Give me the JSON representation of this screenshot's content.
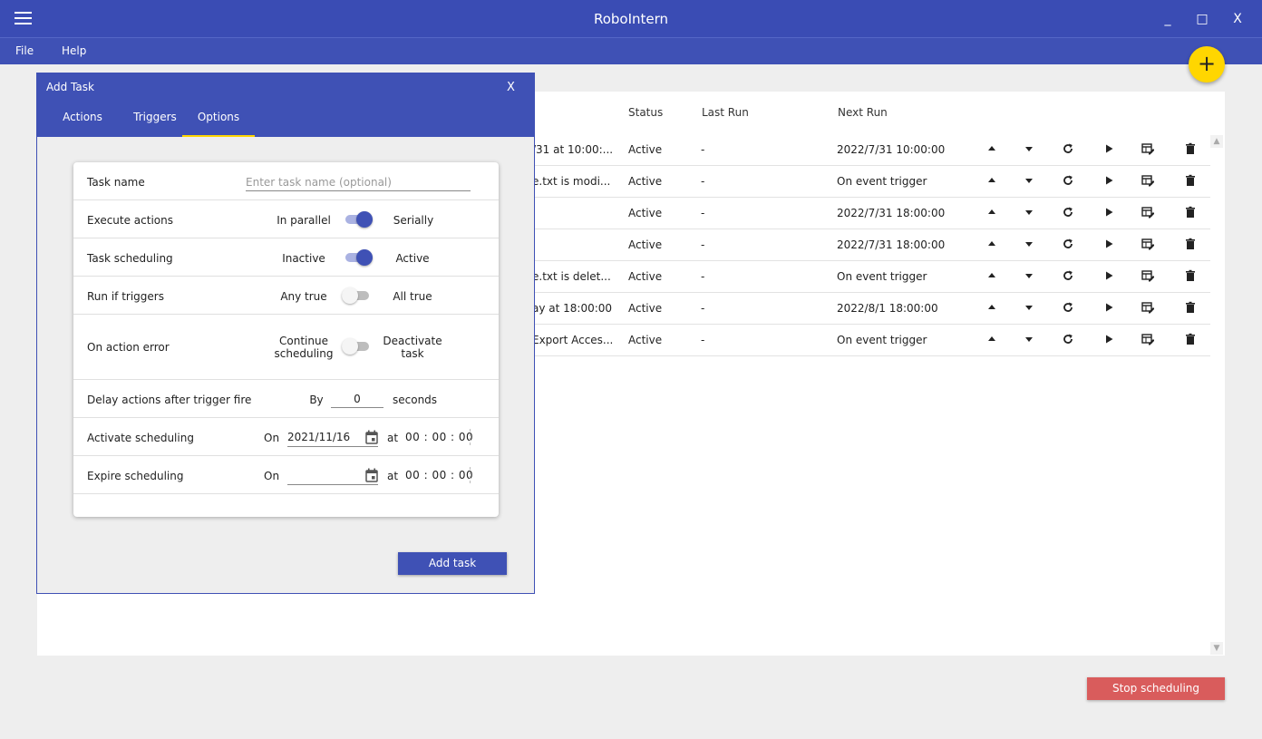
{
  "window": {
    "title": "RoboIntern",
    "minimize": "_",
    "maximize": "□",
    "close": "X"
  },
  "menu": {
    "file": "File",
    "help": "Help"
  },
  "table": {
    "headers": {
      "status": "Status",
      "last_run": "Last Run",
      "next_run": "Next Run"
    },
    "rows": [
      {
        "name": "/31 at 10:00:...",
        "status": "Active",
        "last_run": "-",
        "next_run": "2022/7/31 10:00:00"
      },
      {
        "name": "e.txt is modi...",
        "status": "Active",
        "last_run": "-",
        "next_run": "On event trigger"
      },
      {
        "name": "",
        "status": "Active",
        "last_run": "-",
        "next_run": "2022/7/31 18:00:00"
      },
      {
        "name": "",
        "status": "Active",
        "last_run": "-",
        "next_run": "2022/7/31 18:00:00"
      },
      {
        "name": "e.txt is delet...",
        "status": "Active",
        "last_run": "-",
        "next_run": "On event trigger"
      },
      {
        "name": "ay at 18:00:00",
        "status": "Active",
        "last_run": "-",
        "next_run": "2022/8/1 18:00:00"
      },
      {
        "name": "Export Acces...",
        "status": "Active",
        "last_run": "-",
        "next_run": "On event trigger"
      }
    ]
  },
  "fab": {
    "label": "+"
  },
  "stop_button": "Stop scheduling",
  "dialog": {
    "title": "Add Task",
    "close": "X",
    "tabs": {
      "actions": "Actions",
      "triggers": "Triggers",
      "options": "Options"
    },
    "task_name": {
      "label": "Task name",
      "placeholder": "Enter task name (optional)",
      "value": ""
    },
    "execute_actions": {
      "label": "Execute actions",
      "left": "In parallel",
      "right": "Serially",
      "on": true
    },
    "task_scheduling": {
      "label": "Task scheduling",
      "left": "Inactive",
      "right": "Active",
      "on": true
    },
    "run_if_triggers": {
      "label": "Run if triggers",
      "left": "Any true",
      "right": "All true",
      "on": false
    },
    "on_action_error": {
      "label": "On action error",
      "left_1": "Continue",
      "left_2": "scheduling",
      "right_1": "Deactivate",
      "right_2": "task",
      "on": false
    },
    "delay": {
      "label": "Delay actions after trigger fire",
      "by": "By",
      "value": "0",
      "unit": "seconds"
    },
    "activate": {
      "label": "Activate scheduling",
      "on": "On",
      "date": "2021/11/16",
      "at": "at",
      "time": "00 : 00 : 00"
    },
    "expire": {
      "label": "Expire scheduling",
      "on": "On",
      "date": "",
      "at": "at",
      "time": "00 : 00 : 00"
    },
    "add_button": "Add task"
  },
  "colors": {
    "primary": "#3f51b5",
    "title_bar": "#3a4cb4",
    "accent": "#ffd600",
    "danger": "#d95c5c"
  }
}
